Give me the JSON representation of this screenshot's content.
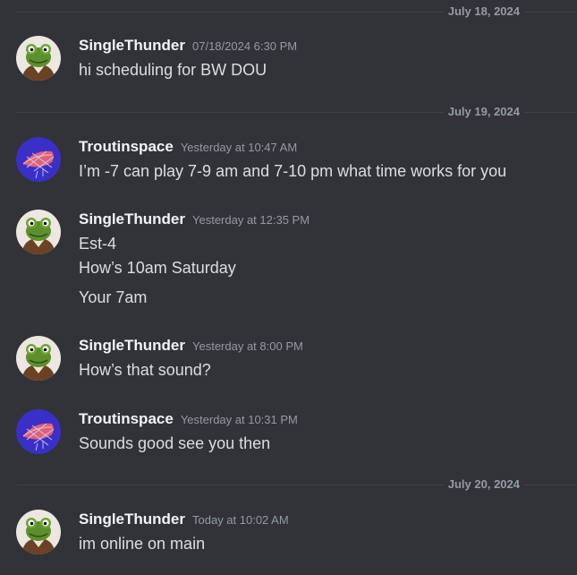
{
  "dividers": [
    {
      "label": "July 18, 2024"
    },
    {
      "label": "July 19, 2024"
    },
    {
      "label": "July 20, 2024"
    }
  ],
  "messages": [
    {
      "author": "SingleThunder",
      "avatar": "frog-avatar-icon",
      "timestamp": "07/18/2024 6:30 PM",
      "lines": [
        "hi scheduling for BW DOU"
      ]
    },
    {
      "author": "Troutinspace",
      "avatar": "fish-net-avatar-icon",
      "timestamp": "Yesterday at 10:47 AM",
      "lines": [
        "I’m -7 can play 7-9 am and 7-10 pm what time works for you"
      ]
    },
    {
      "author": "SingleThunder",
      "avatar": "frog-avatar-icon",
      "timestamp": "Yesterday at 12:35 PM",
      "lines": [
        "Est-4",
        "How’s 10am Saturday",
        "Your 7am"
      ]
    },
    {
      "author": "SingleThunder",
      "avatar": "frog-avatar-icon",
      "timestamp": "Yesterday at 8:00 PM",
      "lines": [
        "How’s that sound?"
      ]
    },
    {
      "author": "Troutinspace",
      "avatar": "fish-net-avatar-icon",
      "timestamp": "Yesterday at 10:31 PM",
      "lines": [
        "Sounds good see you then"
      ]
    },
    {
      "author": "SingleThunder",
      "avatar": "frog-avatar-icon",
      "timestamp": "Today at 10:02 AM",
      "lines": [
        "im online on main"
      ]
    }
  ],
  "colors": {
    "background": "#313338",
    "username": "#f2f3f5",
    "message_text": "#dbdee1",
    "muted": "#949ba4",
    "divider": "#3f4147",
    "trout_avatar_bg": "#3b2fc7",
    "frog_avatar_skin": "#5d8f2c"
  }
}
